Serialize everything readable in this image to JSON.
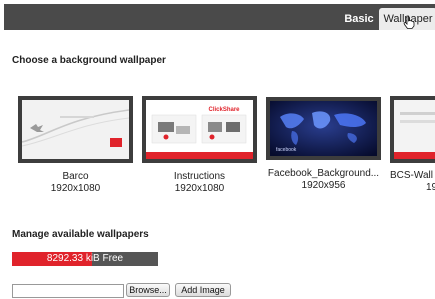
{
  "tabs": {
    "basic": "Basic",
    "wallpaper": "Wallpaper"
  },
  "headings": {
    "choose": "Choose a background wallpaper",
    "manage": "Manage available wallpapers"
  },
  "wallpapers": [
    {
      "name": "Barco",
      "resolution": "1920x1080"
    },
    {
      "name": "Instructions",
      "resolution": "1920x1080"
    },
    {
      "name": "Facebook_Background...",
      "resolution": "1920x956"
    },
    {
      "name": "BCS-Wall",
      "resolution": "19"
    }
  ],
  "thumb_text": {
    "brand": "ClickShare",
    "facebook": "facebook"
  },
  "storage": {
    "label": "8292.33 kiB Free",
    "free_fraction": 0.55
  },
  "upload": {
    "file_value": "",
    "browse_label": "Browse...",
    "add_label": "Add Image"
  },
  "colors": {
    "accent_red": "#e0232b",
    "bar_dark": "#4a4a4a",
    "thumb_border": "#3d3d3d"
  },
  "icons": {
    "cursor": "hand-pointer-icon"
  }
}
